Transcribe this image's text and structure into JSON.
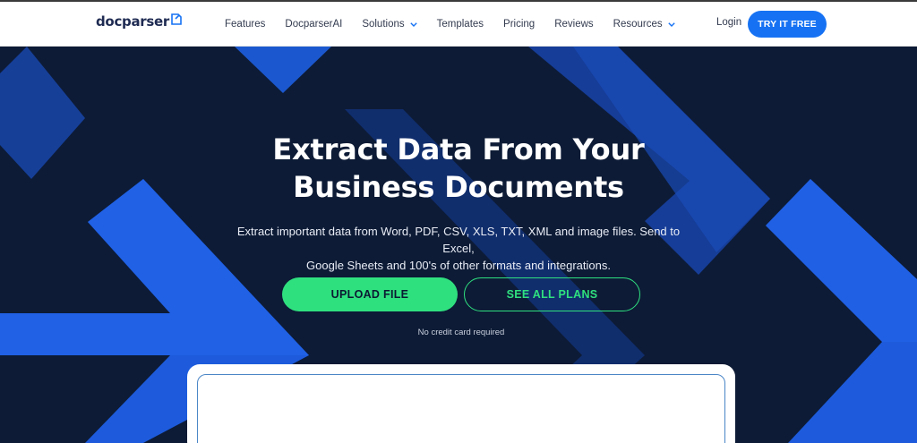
{
  "header": {
    "logo_text": "docparser",
    "nav": [
      {
        "label": "Features"
      },
      {
        "label": "DocparserAI"
      },
      {
        "label": "Solutions",
        "dropdown": true
      },
      {
        "label": "Templates"
      },
      {
        "label": "Pricing"
      },
      {
        "label": "Reviews"
      },
      {
        "label": "Resources",
        "dropdown": true
      }
    ],
    "login_label": "Login",
    "cta_label": "TRY IT FREE"
  },
  "hero": {
    "title_line1": "Extract Data From Your",
    "title_line2": "Business Documents",
    "subtitle_line1": "Extract important data from Word, PDF, CSV, XLS, TXT, XML and image files. Send to Excel,",
    "subtitle_line2": "Google Sheets and 100's of other formats and integrations.",
    "upload_label": "UPLOAD FILE",
    "plans_label": "SEE ALL PLANS",
    "note": "No credit card required"
  },
  "colors": {
    "brand_blue": "#1672f3",
    "accent_green": "#2fe07f",
    "hero_bg": "#0d1b36",
    "chevron_blue": "#1a5ad6"
  }
}
